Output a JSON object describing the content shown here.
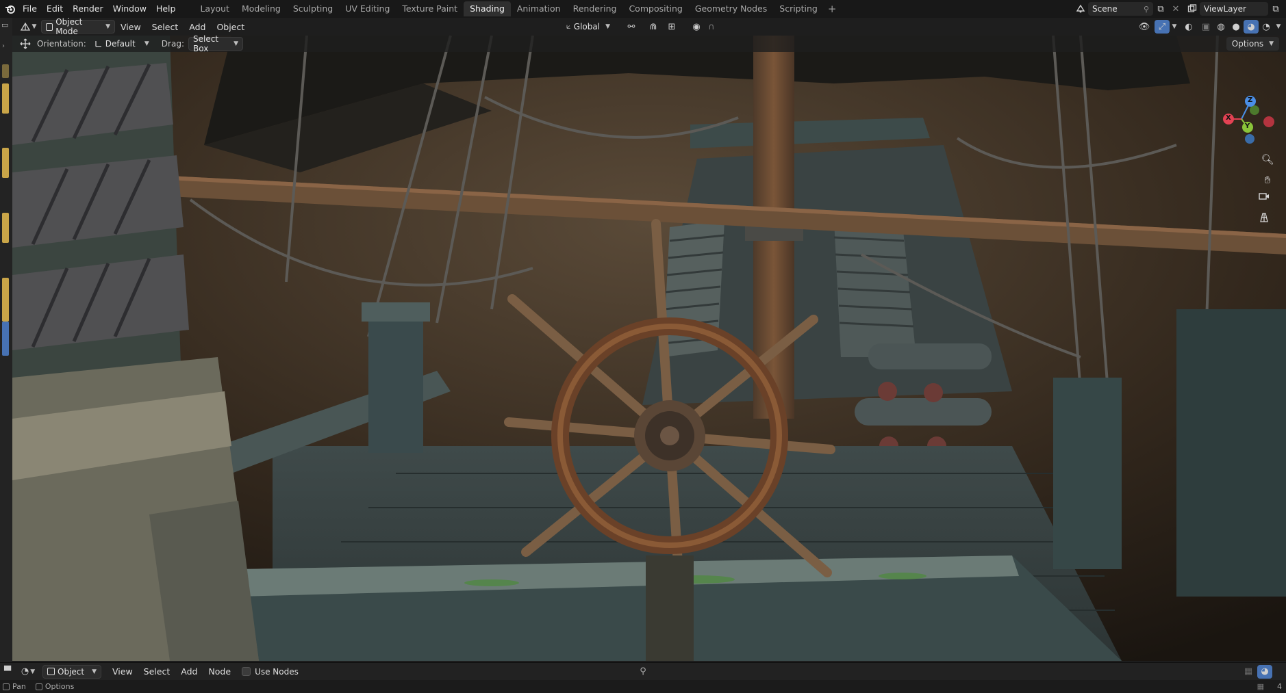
{
  "menu": [
    "File",
    "Edit",
    "Render",
    "Window",
    "Help"
  ],
  "workspaces": [
    "Layout",
    "Modeling",
    "Sculpting",
    "UV Editing",
    "Texture Paint",
    "Shading",
    "Animation",
    "Rendering",
    "Compositing",
    "Geometry Nodes",
    "Scripting"
  ],
  "active_workspace": "Shading",
  "scene": {
    "name": "Scene",
    "view_layer": "ViewLayer"
  },
  "viewport_header": {
    "mode": "Object Mode",
    "menus": [
      "View",
      "Select",
      "Add",
      "Object"
    ],
    "transform_orientation": "Global"
  },
  "tool_header": {
    "orientation_label": "Orientation:",
    "orientation_value": "Default",
    "drag_label": "Drag:",
    "drag_value": "Select Box",
    "options": "Options"
  },
  "gizmo": {
    "x": "X",
    "y": "Y",
    "z": "Z"
  },
  "node_header": {
    "type": "Object",
    "menus": [
      "View",
      "Select",
      "Add",
      "Node"
    ],
    "use_nodes": "Use Nodes"
  },
  "status": {
    "pan": "Pan",
    "options": "Options",
    "version": "4"
  },
  "colors": {
    "accent": "#4772b3",
    "x_axis": "#e34253",
    "y_axis": "#8ac43a",
    "z_axis": "#4a8ee6"
  }
}
